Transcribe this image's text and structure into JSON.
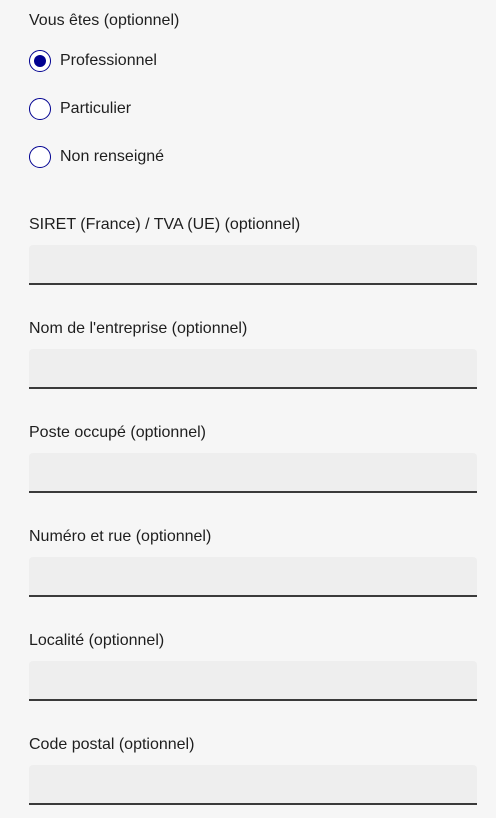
{
  "user_type": {
    "legend": "Vous êtes (optionnel)",
    "options": [
      {
        "label": "Professionnel",
        "checked": true
      },
      {
        "label": "Particulier",
        "checked": false
      },
      {
        "label": "Non renseigné",
        "checked": false
      }
    ]
  },
  "fields": [
    {
      "label": "SIRET (France) / TVA (UE) (optionnel)",
      "value": ""
    },
    {
      "label": "Nom de l'entreprise (optionnel)",
      "value": ""
    },
    {
      "label": "Poste occupé (optionnel)",
      "value": ""
    },
    {
      "label": "Numéro et rue (optionnel)",
      "value": ""
    },
    {
      "label": "Localité (optionnel)",
      "value": ""
    },
    {
      "label": "Code postal (optionnel)",
      "value": ""
    }
  ],
  "colors": {
    "accent": "#000091",
    "input_background": "#eeeeee",
    "input_border": "#3a3a3a",
    "page_background": "#f6f6f6"
  }
}
